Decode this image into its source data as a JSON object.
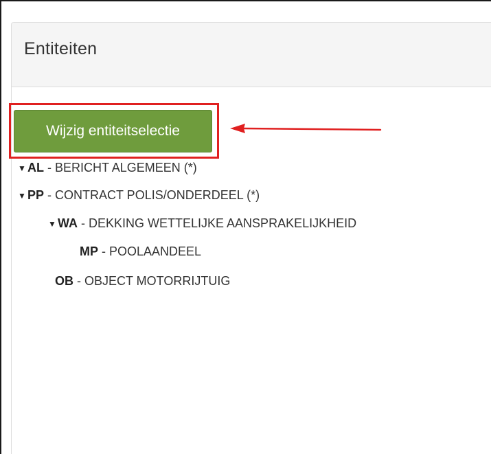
{
  "panel": {
    "title": "Entiteiten",
    "button_label": "Wijzig entiteitselectie"
  },
  "tree": [
    {
      "toggle": "▼",
      "code": "AL",
      "sep": " - ",
      "desc": "BERICHT ALGEMEEN (*)"
    },
    {
      "toggle": "▼",
      "code": "PP",
      "sep": " - ",
      "desc": "CONTRACT POLIS/ONDERDEEL (*)"
    },
    {
      "toggle": "▼",
      "code": "WA",
      "sep": " - ",
      "desc": "DEKKING WETTELIJKE AANSPRAKELIJKHEID"
    },
    {
      "toggle": "",
      "code": "MP",
      "sep": " - ",
      "desc": "POOLAANDEEL"
    },
    {
      "toggle": "",
      "code": "OB",
      "sep": " - ",
      "desc": "OBJECT MOTORRIJTUIG"
    }
  ],
  "colors": {
    "button_bg": "#6f9c3d",
    "highlight": "#e02020",
    "heading_bg": "#f5f5f5"
  },
  "icons": {
    "expanded": "triangle-down-icon",
    "annotation": "red-arrow-left-icon"
  }
}
